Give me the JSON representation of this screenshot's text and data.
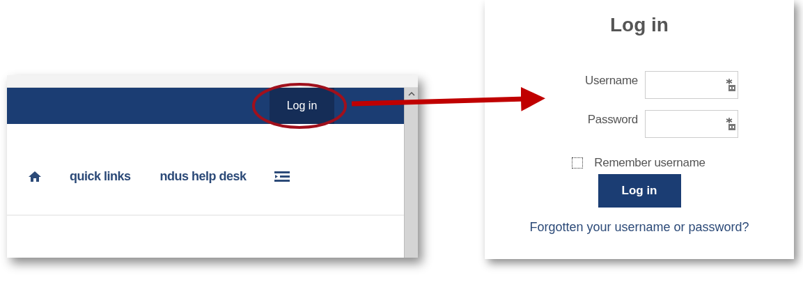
{
  "site_snippet": {
    "header_button": "Log in",
    "nav_links": [
      "quick links",
      "ndus help desk"
    ]
  },
  "login_panel": {
    "title": "Log in",
    "fields": [
      {
        "label": "Username",
        "placeholder_icon": true
      },
      {
        "label": "Password",
        "placeholder_icon": true
      }
    ],
    "remember": {
      "label": "Remember username",
      "checked": false
    },
    "submit": "Log in",
    "forgot_link": "Forgotten your username or password?"
  }
}
